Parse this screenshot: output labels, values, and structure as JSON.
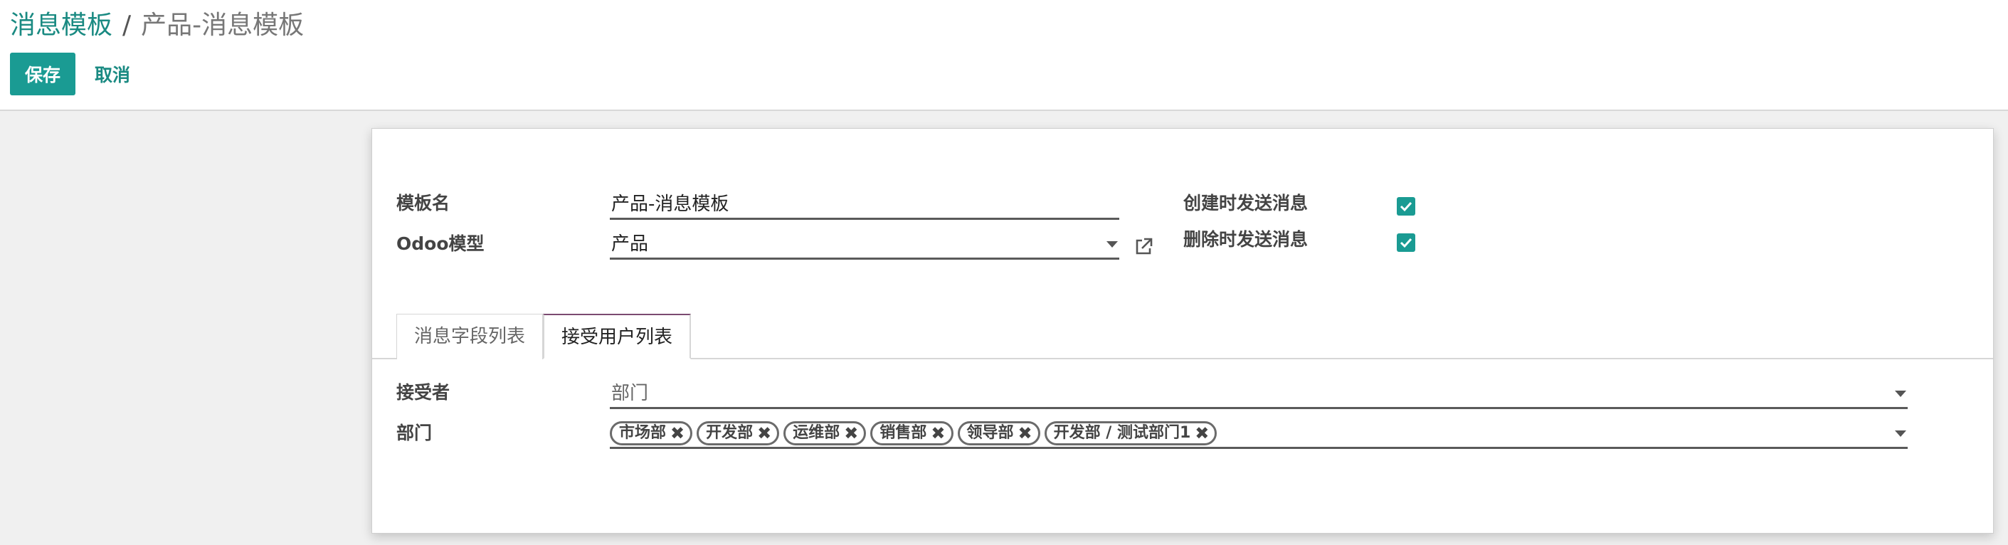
{
  "breadcrumb": {
    "parent": "消息模板",
    "separator": "/",
    "current": "产品-消息模板"
  },
  "actions": {
    "save": "保存",
    "cancel": "取消"
  },
  "form": {
    "template_name_label": "模板名",
    "template_name_value": "产品-消息模板",
    "model_label": "Odoo模型",
    "model_value": "产品",
    "send_on_create_label": "创建时发送消息",
    "send_on_create_checked": true,
    "send_on_delete_label": "删除时发送消息",
    "send_on_delete_checked": true
  },
  "tabs": [
    {
      "label": "消息字段列表",
      "active": false
    },
    {
      "label": "接受用户列表",
      "active": true
    }
  ],
  "recipients": {
    "receiver_label": "接受者",
    "receiver_value": "部门",
    "department_label": "部门",
    "department_tags": [
      "市场部",
      "开发部",
      "运维部",
      "销售部",
      "领导部",
      "开发部 / 测试部门1"
    ]
  },
  "colors": {
    "accent": "#1a9b93",
    "link": "#1a8a82",
    "active_tab_border": "#7b4a71"
  },
  "icons": {
    "external_link": "external-link-icon",
    "remove_tag": "close-icon",
    "checkbox": "check-icon"
  }
}
